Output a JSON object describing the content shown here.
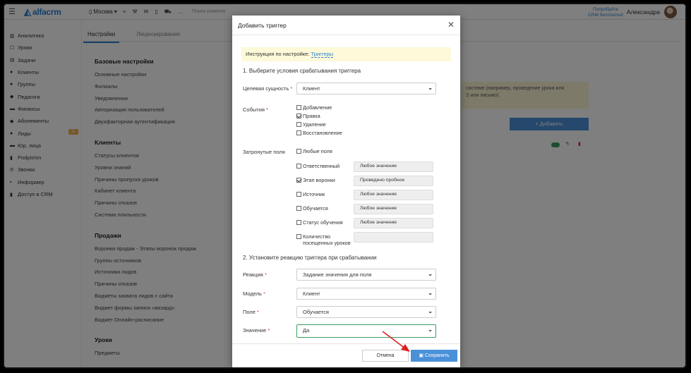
{
  "topbar": {
    "logo": "alfacrm",
    "branch": "Москва",
    "search_placeholder": "Поиск клиента",
    "promo_line1": "Попробуйте",
    "promo_line2": "CRM бесплатно!",
    "user": "Александра"
  },
  "sidebar": {
    "items": [
      {
        "icon": "chart-icon",
        "glyph": "▥",
        "label": "Аналитика"
      },
      {
        "icon": "calendar-icon",
        "glyph": "☐",
        "label": "Уроки"
      },
      {
        "icon": "tasks-icon",
        "glyph": "▤",
        "label": "Задачи"
      },
      {
        "icon": "user-icon",
        "glyph": "●",
        "label": "Клиенты"
      },
      {
        "icon": "users-icon",
        "glyph": "●",
        "label": "Группы"
      },
      {
        "icon": "graduation-icon",
        "glyph": "◆",
        "label": "Педагоги"
      },
      {
        "icon": "money-icon",
        "glyph": "▬",
        "label": "Финансы"
      },
      {
        "icon": "tag-icon",
        "glyph": "◆",
        "label": "Абонементы"
      },
      {
        "icon": "leads-icon",
        "glyph": "●",
        "label": "Лиды",
        "badge": "16"
      },
      {
        "icon": "briefcase-icon",
        "glyph": "▬",
        "label": "Юр. лица"
      },
      {
        "icon": "document-icon",
        "glyph": "▮",
        "label": "Podpis!on"
      },
      {
        "icon": "phone-icon",
        "glyph": "✆",
        "label": "Звонки"
      },
      {
        "icon": "informer-icon",
        "glyph": "▪",
        "label": "Информер"
      },
      {
        "icon": "lock-icon",
        "glyph": "▮",
        "label": "Доступ в CRM"
      }
    ]
  },
  "tabs": {
    "settings": "Настройки",
    "licensing": "Лицензирование"
  },
  "settings": {
    "sections": [
      {
        "title": "Базовые настройки",
        "items": [
          "Основные настройки",
          "Филиалы",
          "Уведомления",
          "Авторизация пользователей",
          "Двухфакторная аутентификация"
        ]
      },
      {
        "title": "Клиенты",
        "items": [
          "Статусы клиентов",
          "Уровни знаний",
          "Причины пропуска уроков",
          "Кабинет клиента",
          "Причины отказов",
          "Система лояльности"
        ]
      },
      {
        "title": "Продажи",
        "items": [
          "Воронки продаж - Этапы воронок продаж",
          "Группы источников",
          "Источники лидов",
          "Причины отказов",
          "Виджеты захвата лидов с сайта",
          "Виджет формы записи «визард»",
          "Виджет Онлайн-расписание"
        ]
      },
      {
        "title": "Уроки",
        "items": [
          "Предметы"
        ]
      }
    ]
  },
  "background": {
    "notice_line1": "системе (например, проведение урока или",
    "notice_line2": "S или письмо).",
    "add_button": "+ Добавить"
  },
  "modal": {
    "title": "Добавить триггер",
    "hint_text": "Инструкция по настройке:",
    "hint_link": "Триггеры",
    "step1": "1. Выберите условия срабатывания триггера",
    "target_label": "Целевая сущность",
    "target_value": "Клиент",
    "events_label": "События",
    "events": [
      {
        "label": "Добавление",
        "checked": false
      },
      {
        "label": "Правка",
        "checked": true
      },
      {
        "label": "Удаление",
        "checked": false
      },
      {
        "label": "Восстановление",
        "checked": false
      }
    ],
    "fields_label": "Затронутые поля",
    "any_fields": "Любые поля",
    "fields": [
      {
        "label": "Ответственный",
        "checked": false,
        "value": "Любое значение",
        "disabled": false
      },
      {
        "label": "Этап воронки",
        "checked": true,
        "value": "Проведено пробное",
        "disabled": false
      },
      {
        "label": "Источник",
        "checked": false,
        "value": "Любое значение",
        "disabled": false
      },
      {
        "label": "Обучается",
        "checked": false,
        "value": "Любое значение",
        "disabled": false
      },
      {
        "label": "Статус обучения",
        "checked": false,
        "value": "Любое значение",
        "disabled": false
      },
      {
        "label": "Количество посещенных уроков",
        "checked": false,
        "value": "",
        "disabled": true
      }
    ],
    "step2": "2. Установите реакцию триггера при срабатывании",
    "reaction_label": "Реакция",
    "reaction_value": "Задание значения для поля",
    "model_label": "Модель",
    "model_value": "Клиент",
    "field_label": "Поле",
    "field_value": "Обучается",
    "value_label": "Значение",
    "value_value": "Да",
    "cancel": "Отмена",
    "save": "Сохранить"
  },
  "colors": {
    "accent": "#4a90d9",
    "required": "#d33333",
    "hint_bg": "#fdf9d9",
    "arrow": "#e02020"
  }
}
